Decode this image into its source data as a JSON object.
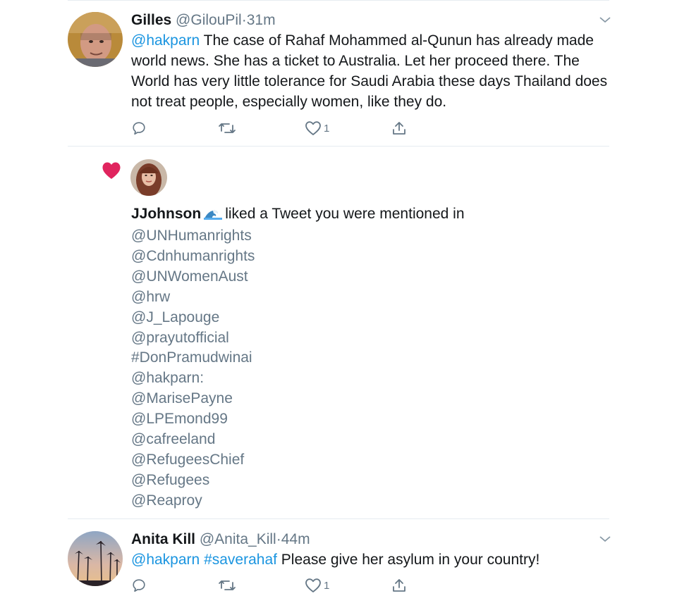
{
  "tweets": [
    {
      "name": "Gilles",
      "handle": "@GilouPil",
      "dot": "·",
      "time": "31m",
      "mention": "@hakparn",
      "text": " The case of Rahaf Mohammed al-Qunun has already made world news.  She has a ticket to Australia.  Let her proceed there.  The World has very little tolerance for Saudi Arabia these days Thailand does not treat people, especially women, like they do.",
      "like_count": "1"
    },
    {
      "name": "Anita Kill",
      "handle": "@Anita_Kill",
      "dot": "·",
      "time": "44m",
      "mention": "@hakparn",
      "hashtag": "#saverahaf",
      "text": " Please give her asylum in your country!",
      "like_count": "1"
    }
  ],
  "notification": {
    "liker_name": "JJohnson",
    "liker_emoji": "wave-emoji",
    "action_text": "liked a Tweet you were mentioned in",
    "mentions": [
      "@UNHumanrights",
      "@Cdnhumanrights",
      "@UNWomenAust",
      "@hrw",
      "@J_Lapouge",
      "@prayutofficial",
      "#DonPramudwinai",
      "@hakparn:",
      "@MarisePayne",
      "@LPEmond99",
      "@cafreeland",
      "@RefugeesChief",
      "@Refugees",
      "@Reaproy"
    ]
  },
  "icons": {
    "reply": "reply-icon",
    "retweet": "retweet-icon",
    "like": "heart-outline-icon",
    "share": "share-icon",
    "menu": "chevron-down-icon",
    "notification": "heart-filled-icon"
  },
  "colors": {
    "link": "#1b95e0",
    "secondary_text": "#657786",
    "primary_text": "#14171a",
    "like_red": "#e0245e",
    "divider": "#e6ecf0"
  }
}
